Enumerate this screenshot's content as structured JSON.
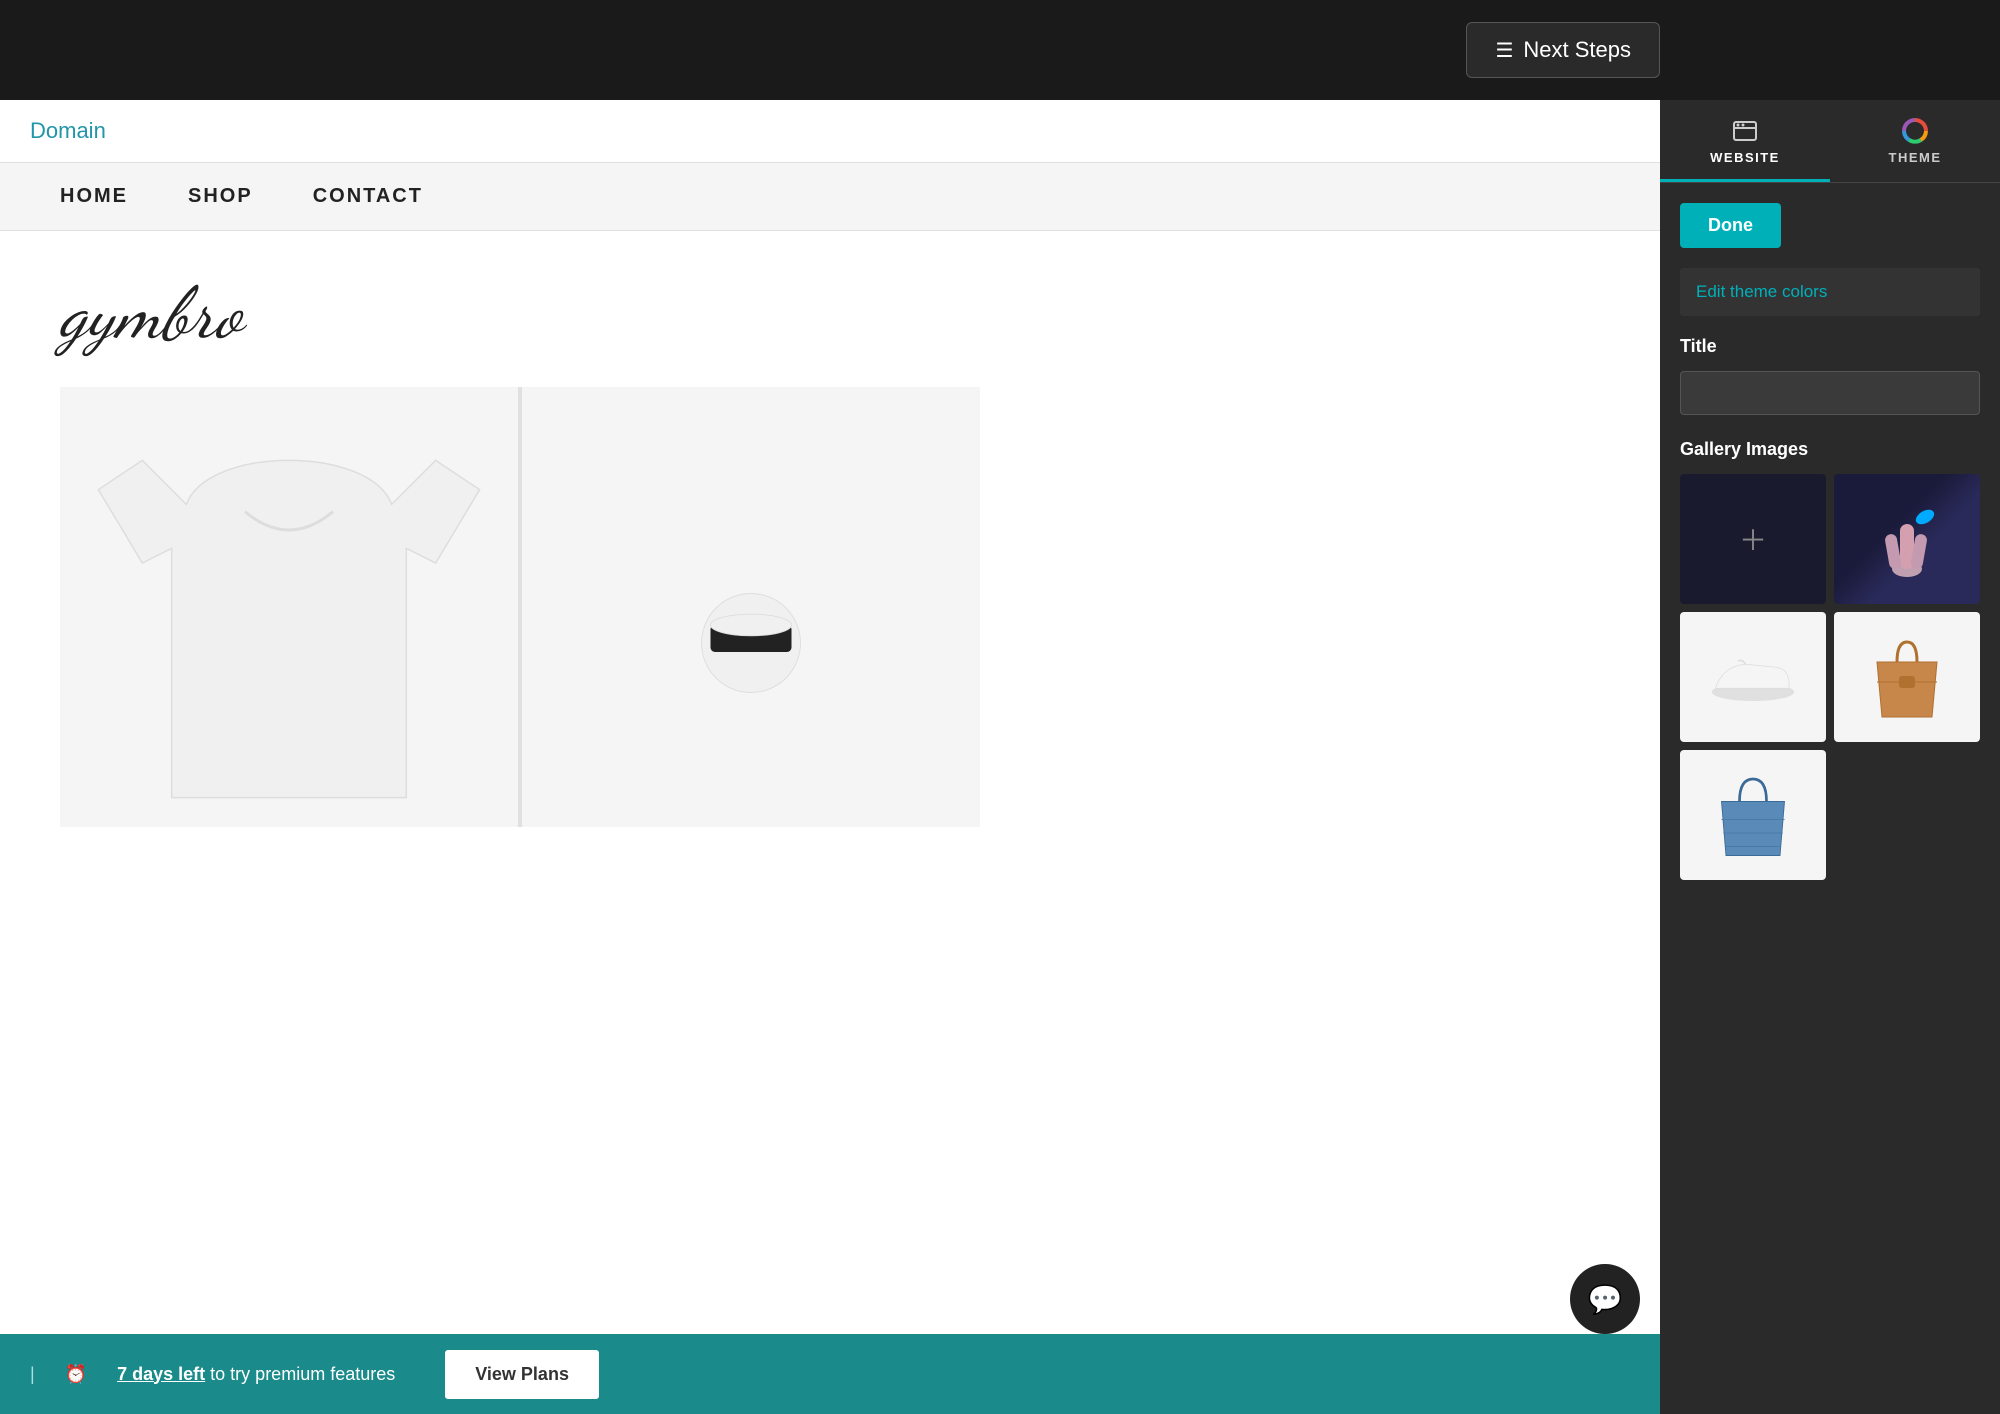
{
  "topbar": {
    "next_steps_label": "Next Steps"
  },
  "preview": {
    "domain_label": "Domain",
    "nav": {
      "items": [
        "HOME",
        "SHOP",
        "CONTACT"
      ]
    },
    "brand_name": "gymbro",
    "products": [
      {
        "id": "tshirt",
        "alt": "White T-shirt"
      },
      {
        "id": "socks",
        "alt": "White socks with black band"
      }
    ],
    "chat_icon": "💬",
    "banner": {
      "separator": "|",
      "trial_icon": "⏰",
      "trial_text": "7 days left",
      "trial_suffix": "to try premium features",
      "view_plans_label": "View Plans"
    }
  },
  "right_panel": {
    "tabs": [
      {
        "id": "website",
        "label": "WEBSITE",
        "active": true
      },
      {
        "id": "theme",
        "label": "THEME",
        "active": false
      }
    ],
    "done_label": "Done",
    "edit_theme_colors_label": "Edit theme colors",
    "title_section": {
      "label": "Title",
      "placeholder": ""
    },
    "gallery_section": {
      "label": "Gallery Images",
      "images": [
        {
          "id": "add",
          "type": "add"
        },
        {
          "id": "hand",
          "type": "hand"
        },
        {
          "id": "sneaker",
          "type": "sneaker"
        },
        {
          "id": "brown-bag",
          "type": "brown-bag"
        },
        {
          "id": "blue-bag",
          "type": "blue-bag"
        }
      ]
    }
  }
}
